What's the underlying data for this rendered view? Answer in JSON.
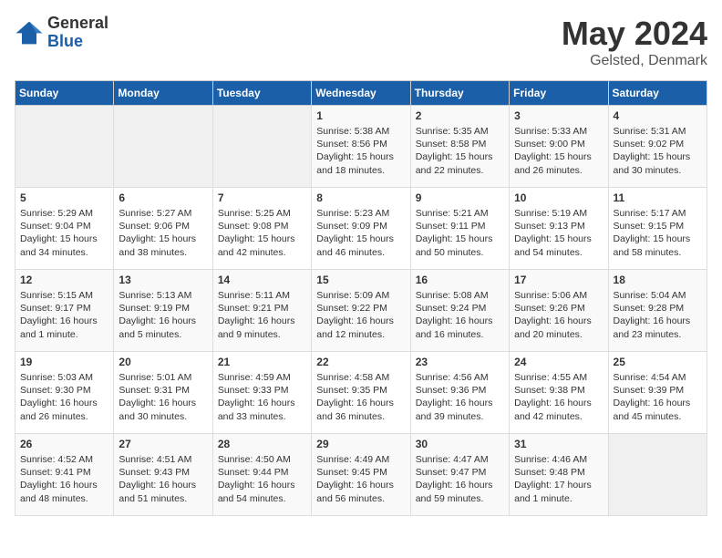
{
  "logo": {
    "general": "General",
    "blue": "Blue"
  },
  "title": "May 2024",
  "subtitle": "Gelsted, Denmark",
  "headers": [
    "Sunday",
    "Monday",
    "Tuesday",
    "Wednesday",
    "Thursday",
    "Friday",
    "Saturday"
  ],
  "weeks": [
    [
      {
        "num": "",
        "info": ""
      },
      {
        "num": "",
        "info": ""
      },
      {
        "num": "",
        "info": ""
      },
      {
        "num": "1",
        "info": "Sunrise: 5:38 AM\nSunset: 8:56 PM\nDaylight: 15 hours\nand 18 minutes."
      },
      {
        "num": "2",
        "info": "Sunrise: 5:35 AM\nSunset: 8:58 PM\nDaylight: 15 hours\nand 22 minutes."
      },
      {
        "num": "3",
        "info": "Sunrise: 5:33 AM\nSunset: 9:00 PM\nDaylight: 15 hours\nand 26 minutes."
      },
      {
        "num": "4",
        "info": "Sunrise: 5:31 AM\nSunset: 9:02 PM\nDaylight: 15 hours\nand 30 minutes."
      }
    ],
    [
      {
        "num": "5",
        "info": "Sunrise: 5:29 AM\nSunset: 9:04 PM\nDaylight: 15 hours\nand 34 minutes."
      },
      {
        "num": "6",
        "info": "Sunrise: 5:27 AM\nSunset: 9:06 PM\nDaylight: 15 hours\nand 38 minutes."
      },
      {
        "num": "7",
        "info": "Sunrise: 5:25 AM\nSunset: 9:08 PM\nDaylight: 15 hours\nand 42 minutes."
      },
      {
        "num": "8",
        "info": "Sunrise: 5:23 AM\nSunset: 9:09 PM\nDaylight: 15 hours\nand 46 minutes."
      },
      {
        "num": "9",
        "info": "Sunrise: 5:21 AM\nSunset: 9:11 PM\nDaylight: 15 hours\nand 50 minutes."
      },
      {
        "num": "10",
        "info": "Sunrise: 5:19 AM\nSunset: 9:13 PM\nDaylight: 15 hours\nand 54 minutes."
      },
      {
        "num": "11",
        "info": "Sunrise: 5:17 AM\nSunset: 9:15 PM\nDaylight: 15 hours\nand 58 minutes."
      }
    ],
    [
      {
        "num": "12",
        "info": "Sunrise: 5:15 AM\nSunset: 9:17 PM\nDaylight: 16 hours\nand 1 minute."
      },
      {
        "num": "13",
        "info": "Sunrise: 5:13 AM\nSunset: 9:19 PM\nDaylight: 16 hours\nand 5 minutes."
      },
      {
        "num": "14",
        "info": "Sunrise: 5:11 AM\nSunset: 9:21 PM\nDaylight: 16 hours\nand 9 minutes."
      },
      {
        "num": "15",
        "info": "Sunrise: 5:09 AM\nSunset: 9:22 PM\nDaylight: 16 hours\nand 12 minutes."
      },
      {
        "num": "16",
        "info": "Sunrise: 5:08 AM\nSunset: 9:24 PM\nDaylight: 16 hours\nand 16 minutes."
      },
      {
        "num": "17",
        "info": "Sunrise: 5:06 AM\nSunset: 9:26 PM\nDaylight: 16 hours\nand 20 minutes."
      },
      {
        "num": "18",
        "info": "Sunrise: 5:04 AM\nSunset: 9:28 PM\nDaylight: 16 hours\nand 23 minutes."
      }
    ],
    [
      {
        "num": "19",
        "info": "Sunrise: 5:03 AM\nSunset: 9:30 PM\nDaylight: 16 hours\nand 26 minutes."
      },
      {
        "num": "20",
        "info": "Sunrise: 5:01 AM\nSunset: 9:31 PM\nDaylight: 16 hours\nand 30 minutes."
      },
      {
        "num": "21",
        "info": "Sunrise: 4:59 AM\nSunset: 9:33 PM\nDaylight: 16 hours\nand 33 minutes."
      },
      {
        "num": "22",
        "info": "Sunrise: 4:58 AM\nSunset: 9:35 PM\nDaylight: 16 hours\nand 36 minutes."
      },
      {
        "num": "23",
        "info": "Sunrise: 4:56 AM\nSunset: 9:36 PM\nDaylight: 16 hours\nand 39 minutes."
      },
      {
        "num": "24",
        "info": "Sunrise: 4:55 AM\nSunset: 9:38 PM\nDaylight: 16 hours\nand 42 minutes."
      },
      {
        "num": "25",
        "info": "Sunrise: 4:54 AM\nSunset: 9:39 PM\nDaylight: 16 hours\nand 45 minutes."
      }
    ],
    [
      {
        "num": "26",
        "info": "Sunrise: 4:52 AM\nSunset: 9:41 PM\nDaylight: 16 hours\nand 48 minutes."
      },
      {
        "num": "27",
        "info": "Sunrise: 4:51 AM\nSunset: 9:43 PM\nDaylight: 16 hours\nand 51 minutes."
      },
      {
        "num": "28",
        "info": "Sunrise: 4:50 AM\nSunset: 9:44 PM\nDaylight: 16 hours\nand 54 minutes."
      },
      {
        "num": "29",
        "info": "Sunrise: 4:49 AM\nSunset: 9:45 PM\nDaylight: 16 hours\nand 56 minutes."
      },
      {
        "num": "30",
        "info": "Sunrise: 4:47 AM\nSunset: 9:47 PM\nDaylight: 16 hours\nand 59 minutes."
      },
      {
        "num": "31",
        "info": "Sunrise: 4:46 AM\nSunset: 9:48 PM\nDaylight: 17 hours\nand 1 minute."
      },
      {
        "num": "",
        "info": ""
      }
    ]
  ]
}
